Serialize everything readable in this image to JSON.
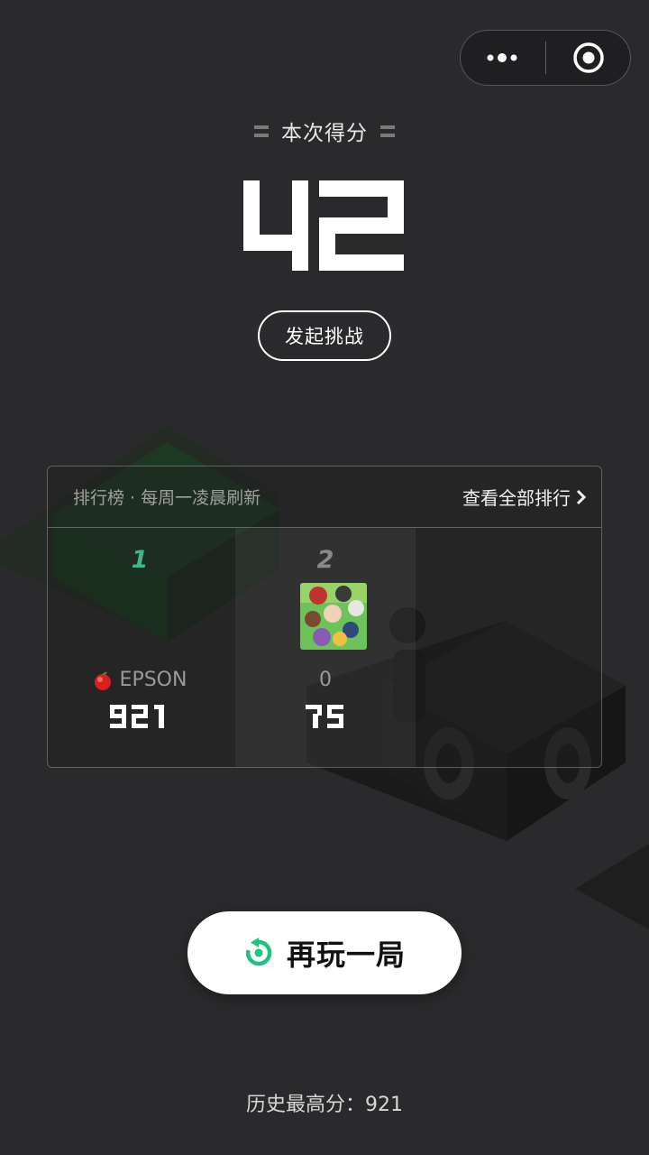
{
  "capsule": {
    "more_icon": "more-dots-icon",
    "close_icon": "target-close-icon"
  },
  "score": {
    "label": "本次得分",
    "value": "42"
  },
  "challenge": {
    "label": "发起挑战"
  },
  "leaderboard": {
    "title": "排行榜 · 每周一凌晨刷新",
    "view_all": "查看全部排行",
    "entries": [
      {
        "rank": "1",
        "name": "EPSON",
        "score": "921",
        "rank_color": "#3fb68a",
        "name_icon": "apple-icon"
      },
      {
        "rank": "2",
        "name": "0",
        "score": "75",
        "rank_color": "#8a8a8a",
        "avatar_icon": "group-photo-avatar"
      }
    ]
  },
  "replay": {
    "label": "再玩一局",
    "icon": "replay-icon",
    "icon_color": "#1fc37a"
  },
  "history": {
    "label": "历史最高分：",
    "value": "921"
  },
  "colors": {
    "background": "#2a2a2c",
    "accent": "#1fc37a"
  }
}
